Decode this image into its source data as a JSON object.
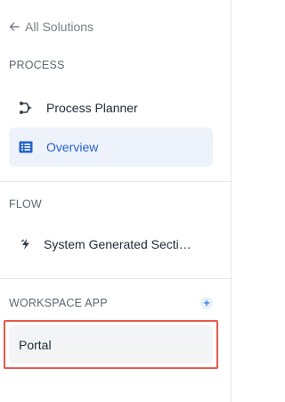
{
  "back": {
    "label": "All Solutions",
    "icon": "arrow-left-icon"
  },
  "sections": {
    "process": {
      "label": "PROCESS",
      "items": [
        {
          "label": "Process Planner",
          "icon": "process-planner-icon",
          "active": false
        },
        {
          "label": "Overview",
          "icon": "list-icon",
          "active": true
        }
      ]
    },
    "flow": {
      "label": "FLOW",
      "items": [
        {
          "label": "System Generated Secti…",
          "icon": "flow-bolt-icon",
          "active": false
        }
      ]
    },
    "workspace_app": {
      "label": "WORKSPACE APP",
      "add_label": "+",
      "items": [
        {
          "label": "Portal",
          "highlighted": true
        }
      ]
    }
  },
  "colors": {
    "accent": "#2563c9",
    "active_bg": "#eef3fb",
    "highlight_outline": "#e8594b",
    "item_bg": "#f3f4f6"
  }
}
